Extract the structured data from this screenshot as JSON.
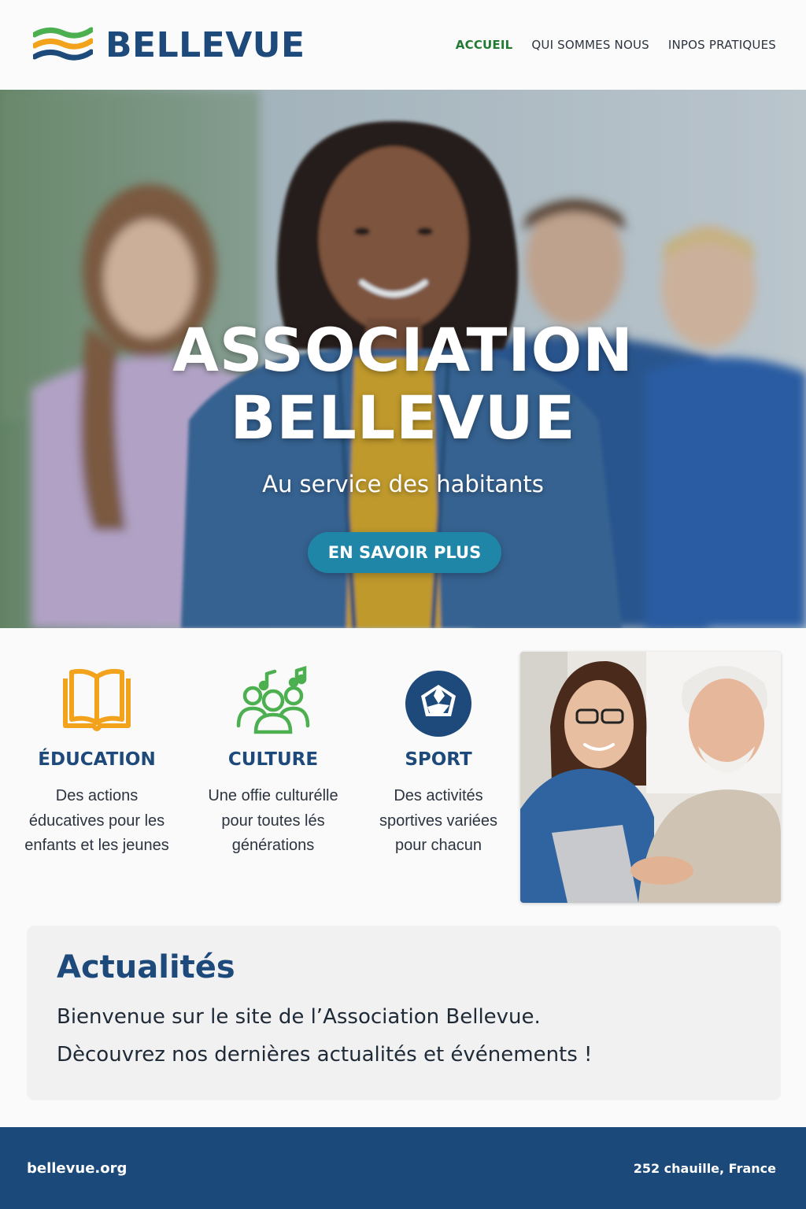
{
  "header": {
    "logo_text": "BELLEVUE",
    "nav": [
      {
        "label": "ACCUEIL",
        "active": true
      },
      {
        "label": "QUI SOMMES NOUS",
        "active": false
      },
      {
        "label": "INPOS PRATIQUES",
        "active": false
      }
    ]
  },
  "hero": {
    "title_line1": "ASSOCIATION",
    "title_line2": "BELLEVUE",
    "subtitle": "Au service des habitants",
    "button_label": "EN SAVOIR PLUS"
  },
  "features": [
    {
      "icon": "book-icon",
      "title": "ÉDUCATION",
      "text": "Des actions éducatives pour les enfants et les jeunes",
      "color": "#f2a31b"
    },
    {
      "icon": "people-music-icon",
      "title": "CULTURE",
      "text": "Une offie culturélle pour toutes lés générations",
      "color": "#4caf50"
    },
    {
      "icon": "soccer-ball-icon",
      "title": "SPORT",
      "text": "Des activités sportives variées pour chacun",
      "color": "#1d4a7a"
    }
  ],
  "news": {
    "title": "Actualités",
    "line1": "Bienvenue sur le site de l’Association Bellevue.",
    "line2": "Dècouvrez nos dernières actualités et événements !"
  },
  "footer": {
    "site": "bellevue.org",
    "address": "252 chauille, France"
  },
  "colors": {
    "brand_blue": "#1d4a7a",
    "nav_active": "#237a33",
    "button": "#1f86a8",
    "footer_bg": "#1b4a7a"
  }
}
